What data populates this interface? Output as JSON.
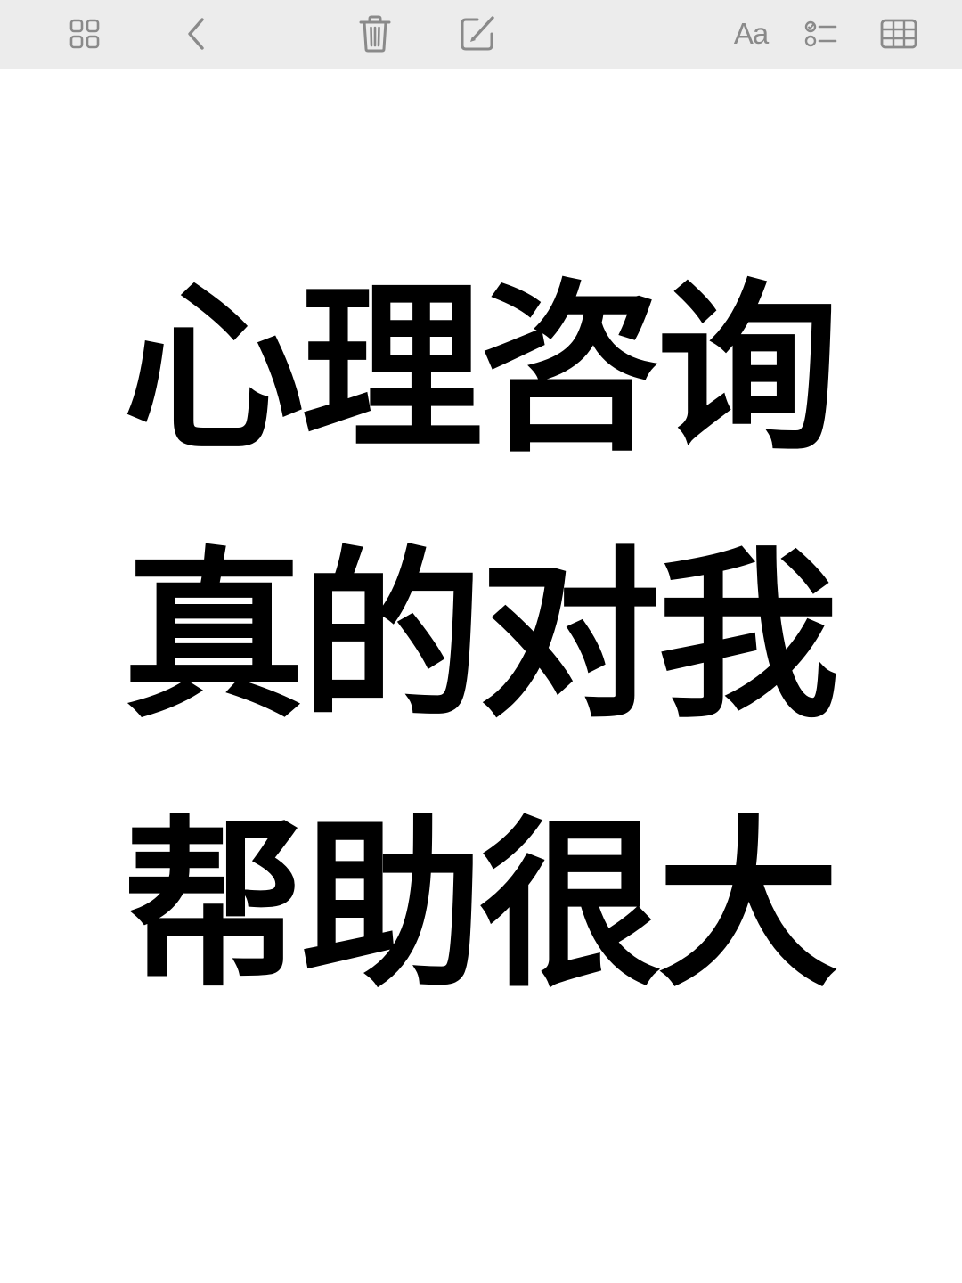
{
  "toolbar": {
    "icons": {
      "gallery": "gallery-grid-icon",
      "back": "chevron-left-icon",
      "delete": "trash-icon",
      "compose": "compose-icon",
      "checklist": "checklist-icon",
      "table": "table-icon"
    },
    "format_label": "Aa",
    "background": "#ececec",
    "icon_color": "#8a8a8a"
  },
  "note": {
    "lines": [
      "心理咨询",
      "真的对我",
      "帮助很大"
    ],
    "text_color": "#000000"
  }
}
